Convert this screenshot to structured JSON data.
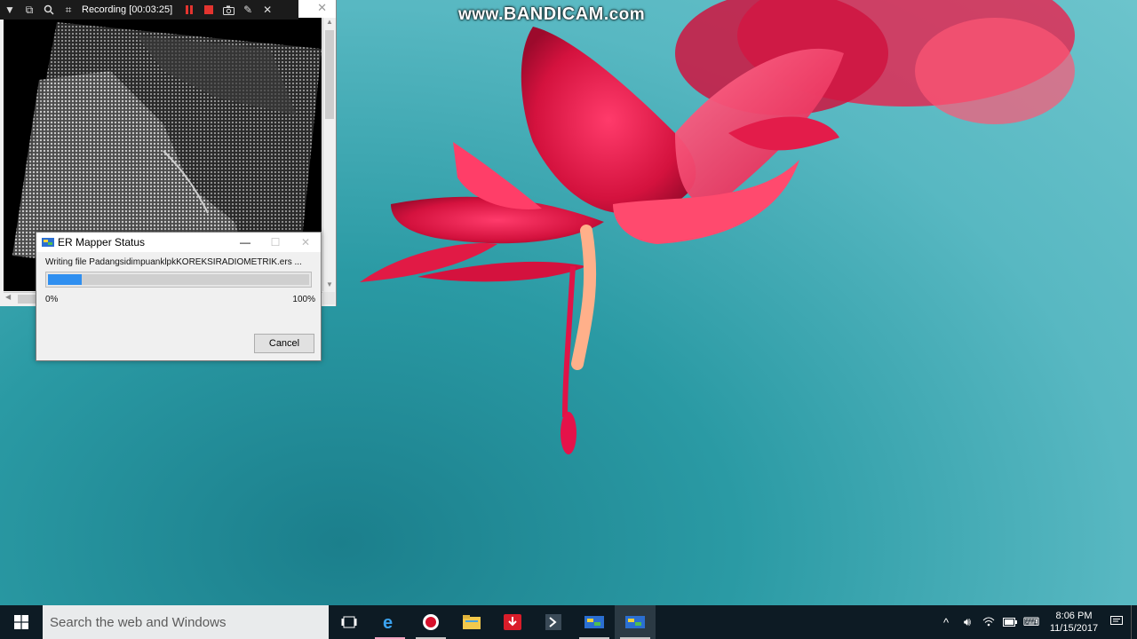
{
  "watermark": {
    "prefix": "www.",
    "brand": "BANDICAM",
    "suffix": ".com"
  },
  "recorder": {
    "label": "Recording [00:03:25]",
    "icons": [
      "chevron-down-icon",
      "window-select-icon",
      "search-icon",
      "crop-icon",
      "pause-icon",
      "stop-icon",
      "camera-icon",
      "pencil-icon",
      "close-icon"
    ]
  },
  "dialog": {
    "title": "ER Mapper Status",
    "message": "Writing file PadangsidimpuanklpkKOREKSIRADIOMETRIK.ers ...",
    "progress": 0.13,
    "min_label": "0%",
    "max_label": "100%",
    "cancel_label": "Cancel",
    "minimize": "—",
    "maximize": "☐",
    "close": "✕"
  },
  "taskbar": {
    "search_placeholder": "Search the web and Windows",
    "apps": [
      "task-view",
      "edge",
      "bandicam",
      "file-explorer",
      "downloader",
      "git-app",
      "er-mapper",
      "er-mapper-active"
    ],
    "time": "8:06 PM",
    "date": "11/15/2017"
  },
  "colors": {
    "accent": "#2f8ff0",
    "taskbar": "#0d1b24",
    "desktop": "#2a9aa4"
  }
}
